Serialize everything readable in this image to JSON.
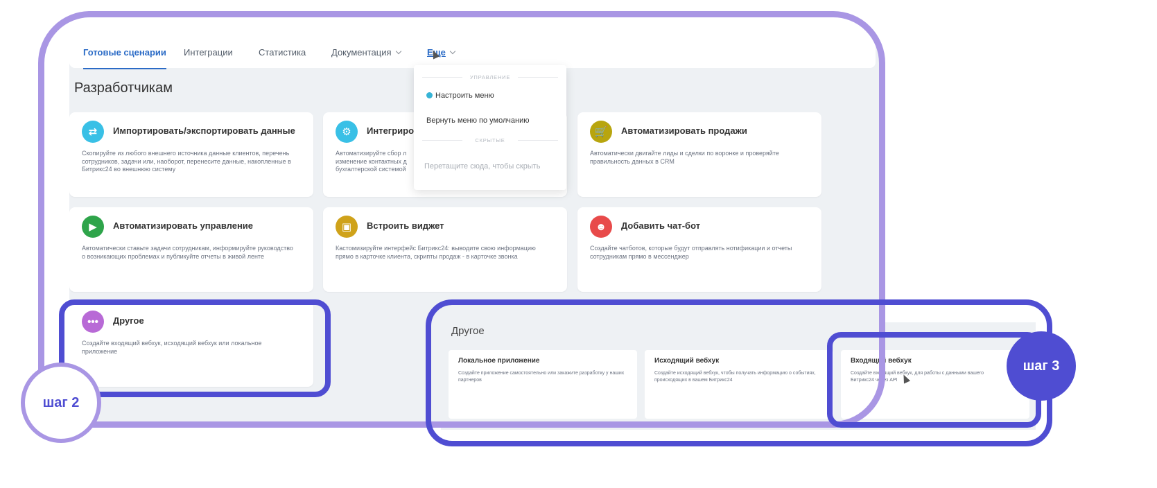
{
  "tabs": [
    {
      "label": "Готовые сценарии"
    },
    {
      "label": "Интеграции"
    },
    {
      "label": "Статистика"
    },
    {
      "label": "Документация"
    },
    {
      "label": "Еще"
    }
  ],
  "section_title": "Разработчикам",
  "cards": [
    {
      "title": "Импортировать/экспортировать данные",
      "desc": "Скопируйте из любого внешнего источника данные клиентов, перечень сотрудников, задачи или, наоборот, перенесите данные, накопленные в Битрикс24 во внешнюю систему",
      "icon": "arrows-swap-icon",
      "color": "#39c0e6"
    },
    {
      "title": "Интегриро",
      "desc": "Автоматизируйте сбор л изменение контактных д бухгалтерской системой",
      "icon": "gears-icon",
      "color": "#39c0e6"
    },
    {
      "title": "Автоматизировать продажи",
      "desc": "Автоматически двигайте лиды и сделки по воронке и проверяйте правильность данных в CRM",
      "icon": "cart-icon",
      "color": "#b8a50e"
    },
    {
      "title": "Автоматизировать управление",
      "desc": "Автоматически ставьте задачи сотрудникам, информируйте руководство о возникающих проблемах и публикуйте отчеты в живой ленте",
      "icon": "play-icon",
      "color": "#2ea44a"
    },
    {
      "title": "Встроить виджет",
      "desc": "Кастомизируйте интерфейс Битрикс24: выводите свою информацию прямо в карточке клиента, скрипты продаж - в карточке звонка",
      "icon": "widget-icon",
      "color": "#cfa21a"
    },
    {
      "title": "Добавить чат-бот",
      "desc": "Создайте чатботов, которые будут отправлять нотификации и отчеты сотрудникам прямо в мессенджер",
      "icon": "bot-icon",
      "color": "#e84a4a"
    },
    {
      "title": "Другое",
      "desc": "Создайте входящий вебхук, исходящий вебхук или локальное приложение",
      "icon": "dots-icon",
      "color": "#b86ad6"
    }
  ],
  "dropdown": {
    "head_manage": "УПРАВЛЕНИЕ",
    "item_configure": "Настроить меню",
    "item_reset": "Вернуть меню по умолчанию",
    "head_hidden": "СКРЫТЫЕ",
    "hint": "Перетащите сюда, чтобы скрыть"
  },
  "inset": {
    "title": "Другое",
    "cards": [
      {
        "title": "Локальное приложение",
        "desc": "Создайте приложение самостоятельно или закажите разработку у наших партнеров"
      },
      {
        "title": "Исходящий вебхук",
        "desc": "Создайте исходящий вебхук, чтобы получать информацию о событиях, происходящих в вашем Битрикс24"
      },
      {
        "title": "Входящий вебхук",
        "desc": "Создайте входящий вебхук, для работы с данными вашего Битрикс24 через API"
      }
    ]
  },
  "steps": {
    "step2": "шаг 2",
    "step3": "шаг 3"
  }
}
